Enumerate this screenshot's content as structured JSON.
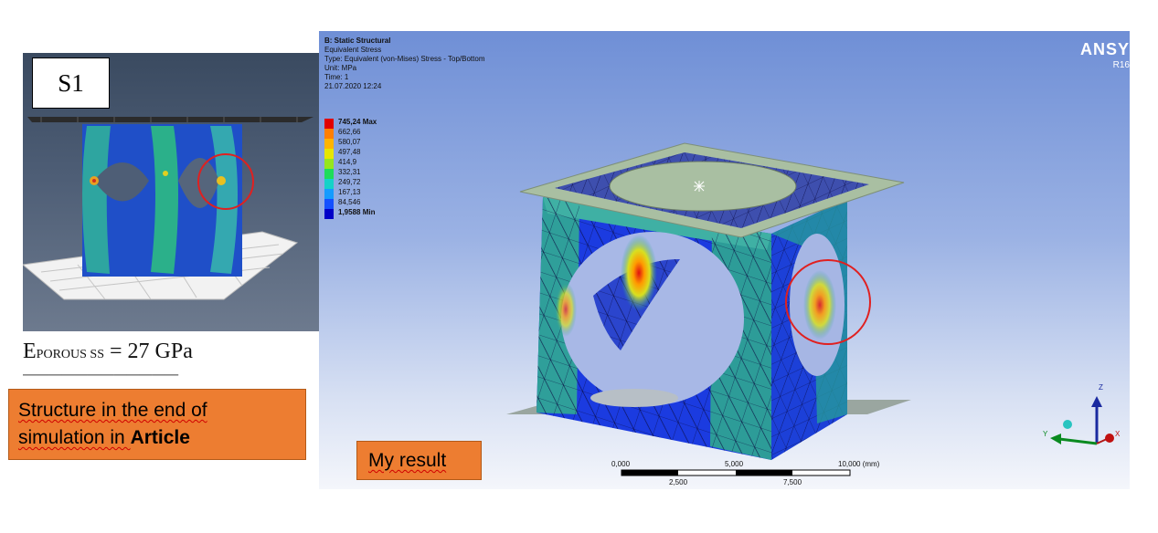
{
  "left": {
    "box_label": "S1",
    "e_main": "E",
    "e_sub": "POROUS SS",
    "e_value": " = 27 GPa",
    "note_prefix": "Structure in the end of simulation in ",
    "note_bold": "Article"
  },
  "ansys": {
    "header": [
      "B: Static Structural",
      "Equivalent Stress",
      "Type: Equivalent (von-Mises) Stress - Top/Bottom",
      "Unit: MPa",
      "Time: 1",
      "21.07.2020 12:24"
    ],
    "logo": "ANSY",
    "version": "R16",
    "legend": [
      {
        "label": "745,24 Max",
        "color": "#e00000"
      },
      {
        "label": "662,66",
        "color": "#ff7f00"
      },
      {
        "label": "580,07",
        "color": "#ffb400"
      },
      {
        "label": "497,48",
        "color": "#e6e600"
      },
      {
        "label": "414,9",
        "color": "#96e61e"
      },
      {
        "label": "332,31",
        "color": "#1edc5a"
      },
      {
        "label": "249,72",
        "color": "#14d2c8"
      },
      {
        "label": "167,13",
        "color": "#149bff"
      },
      {
        "label": "84,546",
        "color": "#1450ff"
      },
      {
        "label": "1,9588 Min",
        "color": "#0000c8"
      }
    ],
    "scale": {
      "top_labels": [
        "0,000",
        "5,000",
        "10,000 (mm)"
      ],
      "bottom_labels": [
        "2,500",
        "7,500"
      ]
    },
    "triad": {
      "z": "Z",
      "y": "Y",
      "x": "X"
    },
    "result_label": "My result"
  },
  "colors": {
    "note_bg": "#ed7d31",
    "highlight_circle": "#e02020"
  }
}
